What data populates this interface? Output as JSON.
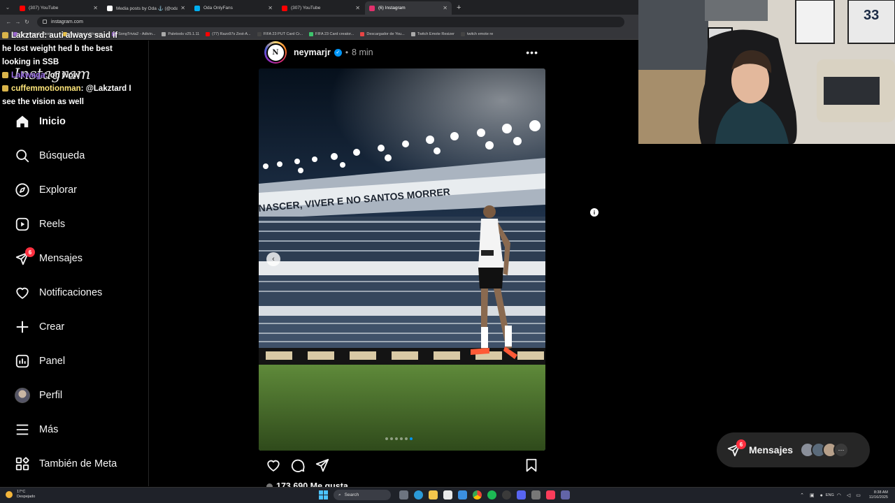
{
  "browser": {
    "tabs": [
      {
        "label": "(307) YouTube",
        "color": "#ff0000"
      },
      {
        "label": "Media posts by Oda ⚓ (@odala",
        "color": "#ffffff"
      },
      {
        "label": "Oda OnlyFans",
        "color": "#00aff0"
      },
      {
        "label": "(307) YouTube",
        "color": "#ff0000"
      },
      {
        "label": "(6) Instagram",
        "color": "#e1306c"
      }
    ],
    "new_tab": "+",
    "url": "instagram.com",
    "bookmarks": [
      {
        "label": "SongTrivia2 - Test y...",
        "color": "#a06cd5"
      },
      {
        "label": "App Store / Streami...",
        "color": "#f2c94c"
      },
      {
        "label": "SongTrivia2 - Adivin...",
        "color": "#a06cd5"
      },
      {
        "label": "Paletools v25.1.11",
        "color": "#aaaaaa"
      },
      {
        "label": "(77) Razo97s Zest-A...",
        "color": "#ff0000"
      },
      {
        "label": "FIFA 23 PUT Card Cr...",
        "color": "#444444"
      },
      {
        "label": "FIFA 23 Card creator...",
        "color": "#3ec46d"
      },
      {
        "label": "Descargador de You...",
        "color": "#e84545"
      },
      {
        "label": "Twitch Emote Resizer",
        "color": "#aaaaaa"
      },
      {
        "label": "twitch emote re",
        "color": "#444444"
      }
    ]
  },
  "chat": {
    "line1_user": "Lakztard",
    "line1_text": ": auti always said if",
    "line2": "he lost weight hed b the best",
    "line3": "looking in SSB",
    "line4_user": "Lakwaga",
    "line4_text": ": oh wow",
    "line5_user": "cuffemmotionman",
    "line5_text": ": @Lakztard I",
    "line6": "see the vision as well"
  },
  "instagram": {
    "logo": "Instagram",
    "nav": [
      {
        "label": "Inicio",
        "icon": "home-icon"
      },
      {
        "label": "Búsqueda",
        "icon": "search-icon"
      },
      {
        "label": "Explorar",
        "icon": "compass-icon"
      },
      {
        "label": "Reels",
        "icon": "reels-icon"
      },
      {
        "label": "Mensajes",
        "icon": "messenger-icon",
        "badge": "6"
      },
      {
        "label": "Notificaciones",
        "icon": "heart-icon"
      },
      {
        "label": "Crear",
        "icon": "plus-icon"
      },
      {
        "label": "Panel",
        "icon": "dashboard-icon"
      },
      {
        "label": "Perfil",
        "icon": "avatar"
      },
      {
        "label": "Más",
        "icon": "menu-icon"
      },
      {
        "label": "También de Meta",
        "icon": "meta-grid-icon"
      }
    ],
    "post": {
      "username": "neymarjr",
      "separator": "•",
      "time": "8 min",
      "more": "•••",
      "image_banner": "NASCER, VIVER E NO SANTOS MORRER",
      "carousel_prev": "‹",
      "likes": "173.690 Me gusta"
    },
    "messages_pill": {
      "label": "Mensajes",
      "badge": "6",
      "more": "···"
    }
  },
  "taskbar": {
    "weather_temp": "17°C",
    "weather_desc": "Despejado",
    "search_label": "Search",
    "language": "ENG",
    "time": "8:38 AM",
    "date": "11/16/2025"
  },
  "colors": {
    "accent": "#0095f6",
    "badge": "#ff3040",
    "background": "#000000"
  }
}
